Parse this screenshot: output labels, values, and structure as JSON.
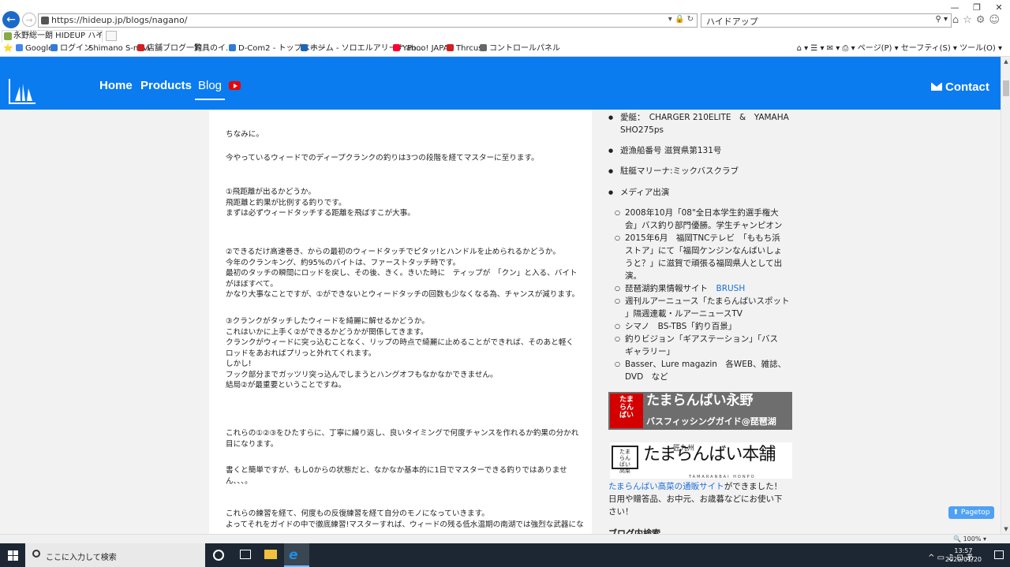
{
  "browser": {
    "url": "https://hideup.jp/blogs/nagano/",
    "search_text": "ハイドアップ",
    "tab_title": "永野総一朗 HIDEUP ハイドア...",
    "window_controls": [
      "—",
      "❐",
      "✕"
    ],
    "favorites": [
      {
        "label": "Google",
        "icon_color": "#4285f4"
      },
      {
        "label": "ログイン",
        "icon_color": "#2f7bd6"
      },
      {
        "label": "Shimano S-navi",
        "icon_color": "#888888"
      },
      {
        "label": "店舗ブログ一覧",
        "icon_color": "#d02020"
      },
      {
        "label": "釣具のイ...",
        "icon_color": "#888888"
      },
      {
        "label": "D-Com2 - トップページ",
        "icon_color": "#2f7bd6"
      },
      {
        "label": "ホーム - ソロエルアリーナ Po...",
        "icon_color": "#1f64b8"
      },
      {
        "label": "Yahoo! JAPAN",
        "icon_color": "#ff0033"
      },
      {
        "label": "Thrcus",
        "icon_color": "#d02020"
      },
      {
        "label": "コントロールパネル",
        "icon_color": "#666666"
      }
    ],
    "command_bar": "ページ(P) ▾   セーフティ(S) ▾   ツール(O) ▾",
    "zoom": "100%"
  },
  "site": {
    "nav": {
      "home": "Home",
      "products": "Products",
      "blog": "Blog",
      "contact": "Contact"
    },
    "accent_color": "#0a7cf0"
  },
  "article": {
    "paragraphs": [
      [
        "ちなみに。"
      ],
      [
        "今やっているウィードでのディープクランクの釣りは3つの段階を経てマスターに至ります。"
      ],
      [
        "①飛距離が出るかどうか。",
        "飛距離と釣果が比例する釣りです。",
        "まずは必ずウィードタッチする距離を飛ばすこが大事。"
      ],
      [
        "②できるだけ高速巻き、からの最初のウィードタッチでピタッ!とハンドルを止められるかどうか。",
        "今年のクランキング、約95%のバイトは、ファーストタッチ時です。",
        "最初のタッチの瞬間にロッドを戻し、その後、きく。きいた時に　ティップが　「クン」と入る、バイト",
        "がほぼすべて。",
        "かなり大事なことですが、①ができないとウィードタッチの回数も少なくなる為、チャンスが減ります。"
      ],
      [
        "③クランクがタッチしたウィードを綺麗に解せるかどうか。",
        "これはいかに上手く②ができるかどうかが関係してきます。",
        "クランクがウィードに突っ込むことなく、リップの時点で綺麗に止めることができれば、そのあと軽く",
        "ロッドをあおればプリっと外れてくれます。",
        "しかし!",
        "フック部分までガッツリ突っ込んでしまうとハングオフもなかなかできません。",
        "結局②が最重要ということですね。"
      ],
      [
        "これらの①②③をひたすらに、丁寧に繰り返し、良いタイミングで何度チャンスを作れるか釣果の分かれ",
        "目になります。"
      ],
      [
        "書くと簡単ですが、もし0からの状態だと、なかなか基本的に1日でマスターできる釣りではありませ",
        "ん、、、。"
      ],
      [
        "これらの練習を経て、何度もの反復練習を経て自分のモノになっていきます。",
        "よってそれをガイドの中で徹底練習!マスターすれば、ウィードの残る低水温期の南湖では強烈な武器にな"
      ]
    ]
  },
  "sidebar": {
    "boat": [
      "愛艇：　CHARGER 210ELITE　&　YAMAHA",
      "SHO275ps"
    ],
    "license": "遊漁船番号 滋賀県第131号",
    "marina": "駐艇マリーナ:ミックバスクラブ",
    "media_title": "メディア出演",
    "media": [
      [
        "2008年10月「08\"全日本学生釣選手権大",
        "会」バス釣り部門優勝。学生チャンピオン"
      ],
      [
        "2015年6月　福岡TNCテレビ　「ももち浜",
        "ストア」にて「福岡ケンジンなんばいしょ",
        "うと？」に滋賀で頑張る福岡県人として出",
        "演。"
      ],
      [
        "琵琶湖釣果情報サイト　"
      ],
      [
        "週刊ルアーニュース「たまらんばいスポット",
        "」隔週連載・ルアーニュースTV"
      ],
      [
        "シマノ　BS-TBS「釣り百景」"
      ],
      [
        "釣りビジョン「ギアステーション」「バス",
        "ギャラリー」"
      ],
      [
        "Basser、Lure magazin　各WEB、雑誌、",
        "DVD　など"
      ]
    ],
    "brush_link": "BRUSH",
    "banner1_red": "たま\nらん\nばい",
    "banner1_title": "たまらんばい永野",
    "banner1_sub": "バスフィッシングガイド@琵琶湖",
    "banner2_box": "たま\nらん\nばい\n高菜",
    "banner2_kyushu": "匠九州",
    "banner2_title": "たまらんばい本舗",
    "banner2_roman": "TAMARANBAI HONPO",
    "shop_link": "たまらんばい高菜の通販サイト",
    "shop_text1": "ができました！",
    "shop_text2": "日用や贈答品、お中元、お歳暮などにお使い下",
    "shop_text3": "さい！",
    "blog_heading": "ブログ内検索",
    "pagetop": "Pagetop"
  },
  "taskbar": {
    "search_placeholder": "ここに入力して検索",
    "time": "13:57",
    "date": "2020/01/20",
    "tray": "^ ▭ ♫ ⊡ あ"
  }
}
